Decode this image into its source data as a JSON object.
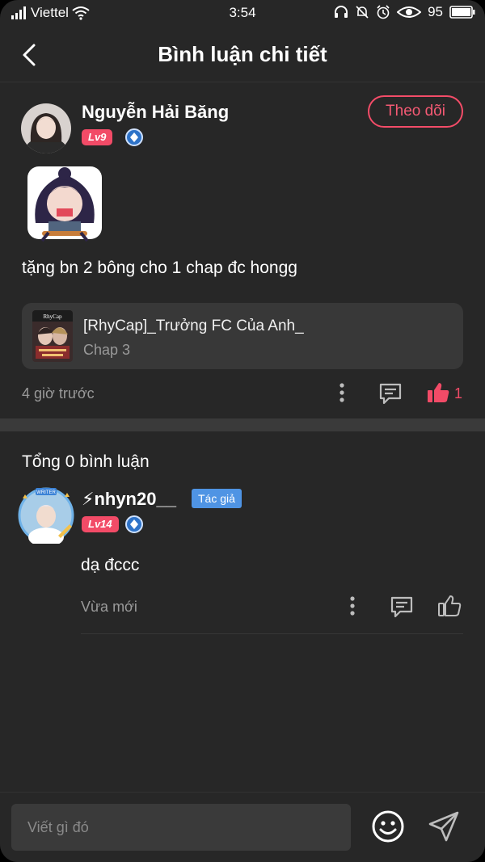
{
  "status_bar": {
    "carrier": "Viettel",
    "time": "3:54",
    "battery": "95"
  },
  "header": {
    "title": "Bình luận chi tiết"
  },
  "comment": {
    "username": "Nguyễn Hải Băng",
    "level": "Lv9",
    "follow_label": "Theo dõi",
    "text": "tặng bn 2 bông cho 1 chap đc hongg",
    "story": {
      "title": "[RhyCap]_Trưởng FC Của Anh_",
      "chapter": "Chap 3"
    },
    "time": "4 giờ trước",
    "like_count": "1"
  },
  "replies_section": {
    "total_label": "Tổng 0 bình luận"
  },
  "reply": {
    "username": "⚡nhyn20__",
    "author_badge": "Tác giả",
    "level": "Lv14",
    "text": "dạ đccc",
    "time": "Vừa mới"
  },
  "composer": {
    "placeholder": "Viết gì đó"
  },
  "colors": {
    "background": "#272727",
    "accent": "#f24b67",
    "author_badge": "#4f94e4",
    "card": "#383838"
  },
  "icons": [
    "signal-icon",
    "wifi-icon",
    "headset-icon",
    "bell-mute-icon",
    "alarm-icon",
    "eye-icon",
    "battery-icon",
    "back-icon",
    "more-icon",
    "comment-icon",
    "like-icon",
    "emoji-icon",
    "send-icon"
  ]
}
